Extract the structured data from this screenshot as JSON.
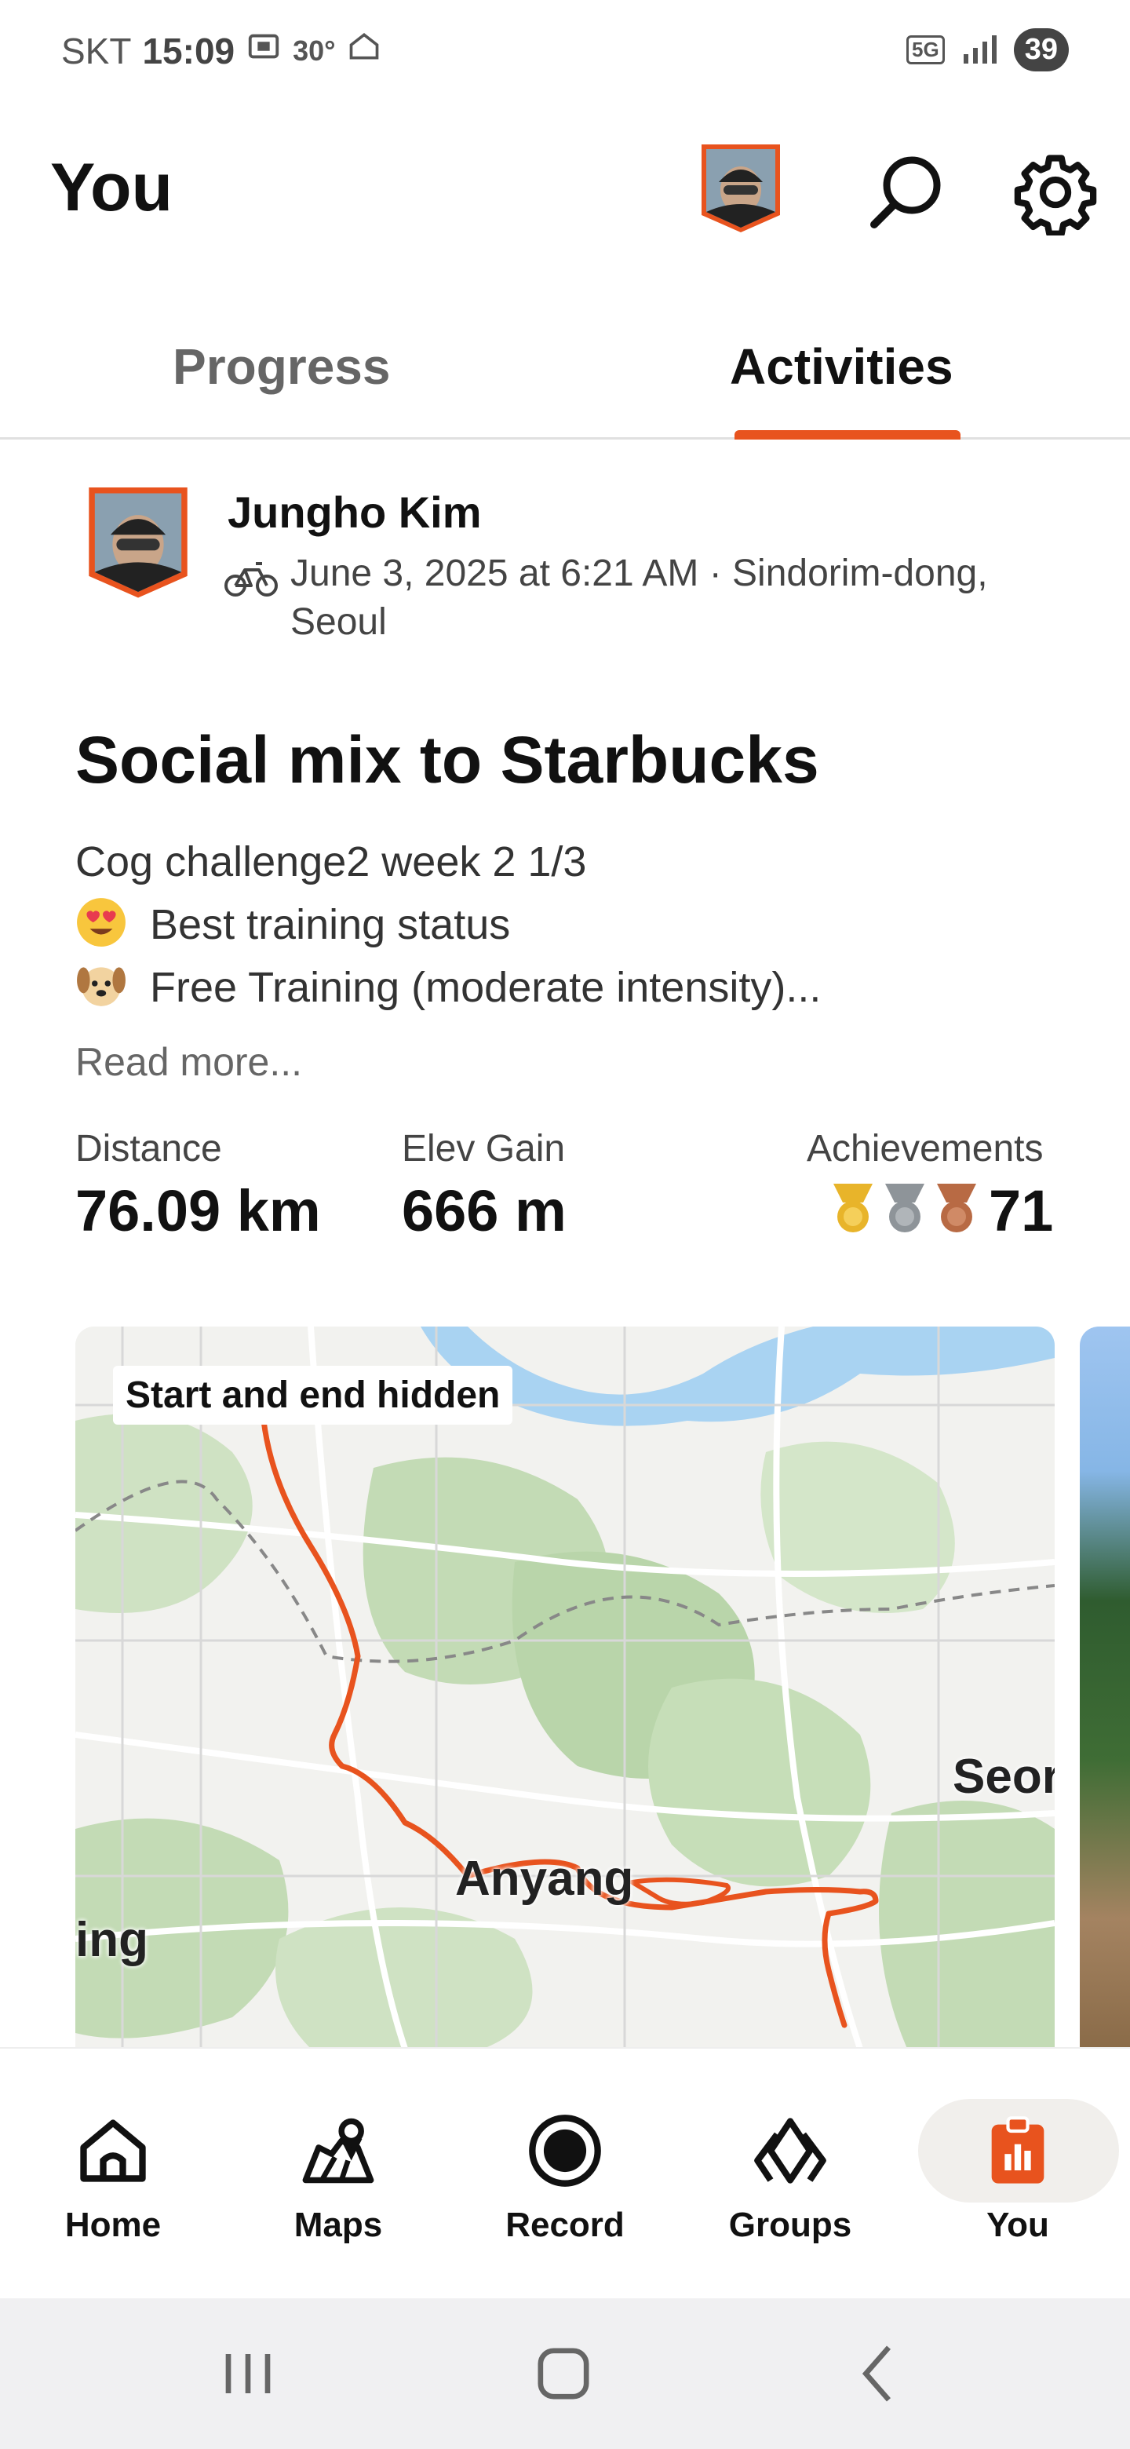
{
  "status_bar": {
    "carrier": "SKT",
    "time": "15:09",
    "temperature": "30°",
    "network": "5G",
    "battery": "39"
  },
  "header": {
    "title": "You"
  },
  "tabs": [
    {
      "label": "Progress",
      "active": false
    },
    {
      "label": "Activities",
      "active": true
    }
  ],
  "activity": {
    "owner_name": "Jungho Kim",
    "activity_type_icon": "bike-icon",
    "meta": "June 3, 2025 at 6:21 AM · Sindorim-dong, Seoul",
    "title": "Social mix to Starbucks",
    "description": [
      {
        "emoji": "",
        "text": "Cog challenge2  week 2 1/3"
      },
      {
        "emoji": "heart-eyes-emoji",
        "text": "Best training status"
      },
      {
        "emoji": "dog-face-emoji",
        "text": "Free Training (moderate intensity)..."
      }
    ],
    "read_more": "Read more...",
    "stats": {
      "distance_label": "Distance",
      "distance_value": "76.09 km",
      "elev_label": "Elev Gain",
      "elev_value": "666 m",
      "achievements_label": "Achievements",
      "achievements_value": "71"
    },
    "map": {
      "chip": "Start and end hidden",
      "labels": {
        "anyang": "Anyang",
        "seongnam": "Seor",
        "left_city": "ing"
      },
      "route_color": "#e8531e"
    }
  },
  "bottom_nav": [
    {
      "label": "Home",
      "icon": "home-icon",
      "active": false
    },
    {
      "label": "Maps",
      "icon": "maps-icon",
      "active": false
    },
    {
      "label": "Record",
      "icon": "record-icon",
      "active": false
    },
    {
      "label": "Groups",
      "icon": "groups-icon",
      "active": false
    },
    {
      "label": "You",
      "icon": "you-icon",
      "active": true
    }
  ],
  "colors": {
    "accent": "#e8531e",
    "gold": "#e8b42a",
    "silver": "#8e9499",
    "bronze": "#b86a44"
  }
}
